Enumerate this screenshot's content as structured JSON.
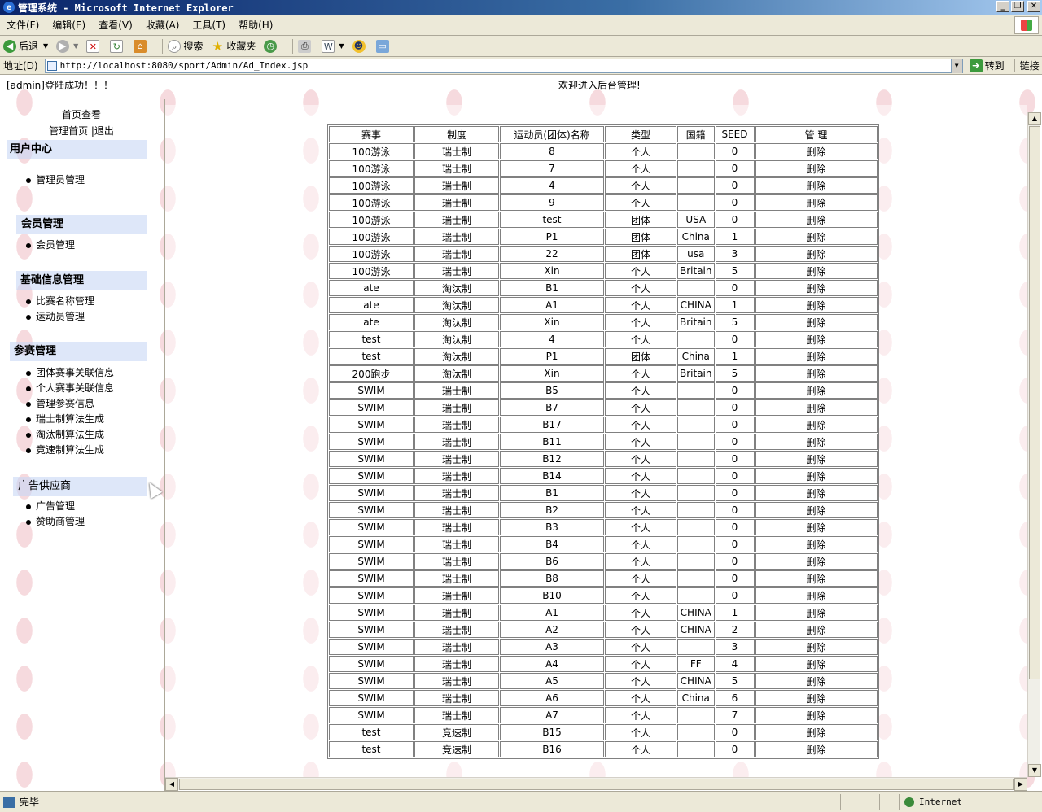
{
  "window": {
    "title": "管理系统 - Microsoft Internet Explorer"
  },
  "menubar": {
    "items": [
      "文件(F)",
      "编辑(E)",
      "查看(V)",
      "收藏(A)",
      "工具(T)",
      "帮助(H)"
    ]
  },
  "toolbar": {
    "back_label": "后退",
    "search_label": "搜索",
    "favorites_label": "收藏夹"
  },
  "addressbar": {
    "label": "地址(D)",
    "url": "http://localhost:8080/sport/Admin/Ad_Index.jsp",
    "go_label": "转到",
    "links_label": "链接"
  },
  "page": {
    "login_message": "[admin]登陆成功！！！",
    "welcome": "欢迎进入后台管理!"
  },
  "sidebar": {
    "home_view": "首页查看",
    "home_logout": "管理首页 |退出",
    "sections": [
      {
        "title": "用户中心",
        "items": [
          "管理员管理"
        ]
      },
      {
        "title": "会员管理",
        "items": [
          "会员管理"
        ]
      },
      {
        "title": "基础信息管理",
        "items": [
          "比赛名称管理",
          "运动员管理"
        ]
      },
      {
        "title": "参赛管理",
        "items": [
          "团体赛事关联信息",
          "个人赛事关联信息",
          "管理参赛信息",
          "瑞士制算法生成",
          "淘汰制算法生成",
          "竞速制算法生成"
        ]
      },
      {
        "title": "广告供应商",
        "items": [
          "广告管理",
          "赞助商管理"
        ]
      }
    ]
  },
  "table": {
    "headers": [
      "赛事",
      "制度",
      "运动员(团体)名称",
      "类型",
      "国籍",
      "SEED",
      "管 理"
    ],
    "delete_label": "删除",
    "rows": [
      [
        "100游泳",
        "瑞士制",
        "8",
        "个人",
        "",
        "0"
      ],
      [
        "100游泳",
        "瑞士制",
        "7",
        "个人",
        "",
        "0"
      ],
      [
        "100游泳",
        "瑞士制",
        "4",
        "个人",
        "",
        "0"
      ],
      [
        "100游泳",
        "瑞士制",
        "9",
        "个人",
        "",
        "0"
      ],
      [
        "100游泳",
        "瑞士制",
        "test",
        "团体",
        "USA",
        "0"
      ],
      [
        "100游泳",
        "瑞士制",
        "P1",
        "团体",
        "China",
        "1"
      ],
      [
        "100游泳",
        "瑞士制",
        "22",
        "团体",
        "usa",
        "3"
      ],
      [
        "100游泳",
        "瑞士制",
        "Xin",
        "个人",
        "Britain",
        "5"
      ],
      [
        "ate",
        "淘汰制",
        "B1",
        "个人",
        "",
        "0"
      ],
      [
        "ate",
        "淘汰制",
        "A1",
        "个人",
        "CHINA",
        "1"
      ],
      [
        "ate",
        "淘汰制",
        "Xin",
        "个人",
        "Britain",
        "5"
      ],
      [
        "test",
        "淘汰制",
        "4",
        "个人",
        "",
        "0"
      ],
      [
        "test",
        "淘汰制",
        "P1",
        "团体",
        "China",
        "1"
      ],
      [
        "200跑步",
        "淘汰制",
        "Xin",
        "个人",
        "Britain",
        "5"
      ],
      [
        "SWIM",
        "瑞士制",
        "B5",
        "个人",
        "",
        "0"
      ],
      [
        "SWIM",
        "瑞士制",
        "B7",
        "个人",
        "",
        "0"
      ],
      [
        "SWIM",
        "瑞士制",
        "B17",
        "个人",
        "",
        "0"
      ],
      [
        "SWIM",
        "瑞士制",
        "B11",
        "个人",
        "",
        "0"
      ],
      [
        "SWIM",
        "瑞士制",
        "B12",
        "个人",
        "",
        "0"
      ],
      [
        "SWIM",
        "瑞士制",
        "B14",
        "个人",
        "",
        "0"
      ],
      [
        "SWIM",
        "瑞士制",
        "B1",
        "个人",
        "",
        "0"
      ],
      [
        "SWIM",
        "瑞士制",
        "B2",
        "个人",
        "",
        "0"
      ],
      [
        "SWIM",
        "瑞士制",
        "B3",
        "个人",
        "",
        "0"
      ],
      [
        "SWIM",
        "瑞士制",
        "B4",
        "个人",
        "",
        "0"
      ],
      [
        "SWIM",
        "瑞士制",
        "B6",
        "个人",
        "",
        "0"
      ],
      [
        "SWIM",
        "瑞士制",
        "B8",
        "个人",
        "",
        "0"
      ],
      [
        "SWIM",
        "瑞士制",
        "B10",
        "个人",
        "",
        "0"
      ],
      [
        "SWIM",
        "瑞士制",
        "A1",
        "个人",
        "CHINA",
        "1"
      ],
      [
        "SWIM",
        "瑞士制",
        "A2",
        "个人",
        "CHINA",
        "2"
      ],
      [
        "SWIM",
        "瑞士制",
        "A3",
        "个人",
        "",
        "3"
      ],
      [
        "SWIM",
        "瑞士制",
        "A4",
        "个人",
        "FF",
        "4"
      ],
      [
        "SWIM",
        "瑞士制",
        "A5",
        "个人",
        "CHINA",
        "5"
      ],
      [
        "SWIM",
        "瑞士制",
        "A6",
        "个人",
        "China",
        "6"
      ],
      [
        "SWIM",
        "瑞士制",
        "A7",
        "个人",
        "",
        "7"
      ],
      [
        "test",
        "竞速制",
        "B15",
        "个人",
        "",
        "0"
      ],
      [
        "test",
        "竞速制",
        "B16",
        "个人",
        "",
        "0"
      ]
    ]
  },
  "statusbar": {
    "status": "完毕",
    "zone": "Internet"
  },
  "colors": {
    "titlebar": "#0a246a",
    "chrome": "#ece9d8",
    "section_bg": "#c8d7f5"
  }
}
